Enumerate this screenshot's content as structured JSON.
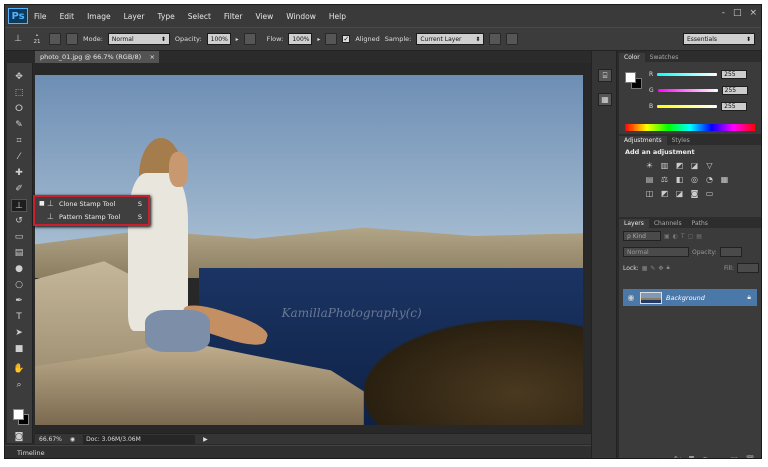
{
  "menu": [
    "File",
    "Edit",
    "Image",
    "Layer",
    "Type",
    "Select",
    "Filter",
    "View",
    "Window",
    "Help"
  ],
  "app_logo": "Ps",
  "window_controls": [
    "-",
    "□",
    "×"
  ],
  "options": {
    "brush_size": "21",
    "mode_label": "Mode:",
    "mode_value": "Normal",
    "opacity_label": "Opacity:",
    "opacity_value": "100%",
    "flow_label": "Flow:",
    "flow_value": "100%",
    "aligned_label": "Aligned",
    "sample_label": "Sample:",
    "sample_value": "Current Layer",
    "workspace": "Essentials"
  },
  "document_tab": {
    "title": "photo_01.jpg @ 66.7% (RGB/8)",
    "close": "×"
  },
  "flyout": [
    {
      "mark": "■",
      "label": "Clone Stamp Tool",
      "shortcut": "S"
    },
    {
      "mark": "",
      "label": "Pattern Stamp Tool",
      "shortcut": "S"
    }
  ],
  "watermark": "KamillaPhotography(c)",
  "status": {
    "zoom": "66.67%",
    "doc": "Doc: 3.06M/3.06M"
  },
  "timeline_label": "Timeline",
  "color_panel": {
    "tabs": [
      "Color",
      "Swatches"
    ],
    "rows": [
      {
        "label": "R",
        "value": "255",
        "color": "#ff6a6a"
      },
      {
        "label": "G",
        "value": "255",
        "color": "#5cff5c"
      },
      {
        "label": "B",
        "value": "255",
        "color": "#6a8cff"
      }
    ]
  },
  "adjustments_panel": {
    "tabs": [
      "Adjustments",
      "Styles"
    ],
    "title": "Add an adjustment"
  },
  "layers_panel": {
    "tabs": [
      "Layers",
      "Channels",
      "Paths"
    ],
    "kind_label": "ρ Kind",
    "blend_mode": "Normal",
    "opacity_label": "Opacity:",
    "lock_label": "Lock:",
    "fill_label": "Fill:",
    "layer_name": "Background"
  },
  "colors": {
    "ps_blue": "#4fb4ff",
    "highlight": "#c8202f",
    "layer_selected": "#4a78a8"
  }
}
